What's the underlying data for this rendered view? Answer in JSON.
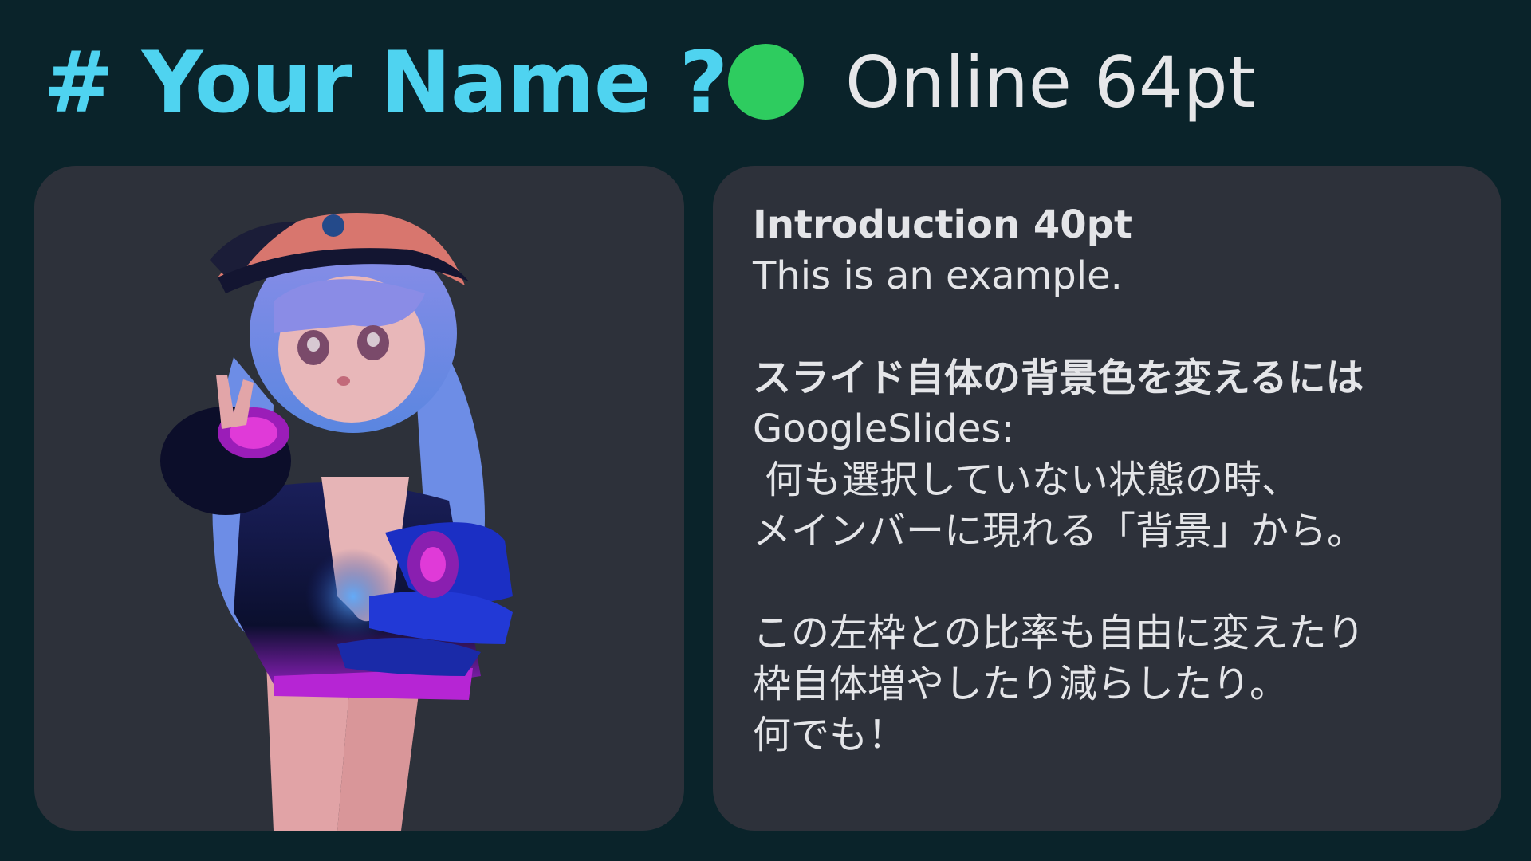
{
  "header": {
    "title": "# Your Name ?",
    "status_label": "Online 64pt",
    "status_color": "#2ecc5f",
    "title_color": "#4fd3f0"
  },
  "left_panel": {
    "image": "vrchat-avatar-illustration"
  },
  "right_panel": {
    "heading": "Introduction 40pt",
    "intro": "This is an example.",
    "subheading": "スライド自体の背景色を変えるには",
    "line1": "GoogleSlides:",
    "line2": " 何も選択していない状態の時、",
    "line3": "メインバーに現れる「背景」から。",
    "line4": "この左枠との比率も自由に変えたり",
    "line5": "枠自体増やしたり減らしたり。",
    "line6": "何でも！"
  },
  "colors": {
    "background": "#0a232a",
    "card": "#2d313a",
    "text": "#e4e5e8"
  }
}
